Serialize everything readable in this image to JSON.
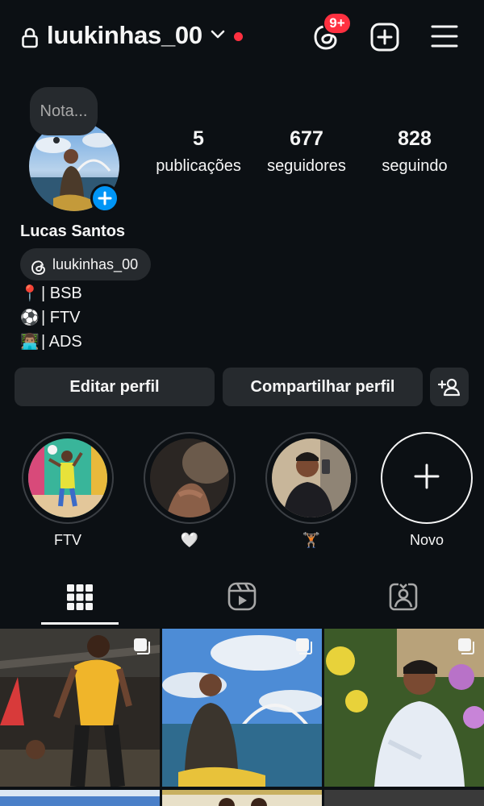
{
  "header": {
    "username": "luukinhas_00",
    "notification_badge": "9+",
    "lock_icon": "lock-icon",
    "accent_color": "#ff3040"
  },
  "profile": {
    "note_placeholder": "Nota...",
    "display_name": "Lucas Santos",
    "threads_handle": "luukinhas_00",
    "stats": [
      {
        "value": "5",
        "label": "publicações"
      },
      {
        "value": "677",
        "label": "seguidores"
      },
      {
        "value": "828",
        "label": "seguindo"
      }
    ],
    "bio": [
      {
        "emoji": "📍",
        "text": "| BSB"
      },
      {
        "emoji": "⚽",
        "text": "| FTV"
      },
      {
        "emoji": "👨🏽‍💻",
        "text": "| ADS"
      }
    ]
  },
  "actions": {
    "edit_label": "Editar perfil",
    "share_label": "Compartilhar perfil",
    "add_person_icon": "add-person-icon"
  },
  "highlights": [
    {
      "label": "FTV"
    },
    {
      "label": "🤍"
    },
    {
      "label": "🏋🏽"
    },
    {
      "label": "Novo"
    }
  ],
  "tabs": [
    {
      "icon": "grid-icon",
      "active": true
    },
    {
      "icon": "reels-icon",
      "active": false
    },
    {
      "icon": "tagged-icon",
      "active": false
    }
  ],
  "posts": [
    {
      "type": "carousel"
    },
    {
      "type": "carousel"
    },
    {
      "type": "carousel"
    }
  ],
  "colors": {
    "background": "#0c1014",
    "surface": "#262a2e",
    "blue": "#0095f6"
  }
}
